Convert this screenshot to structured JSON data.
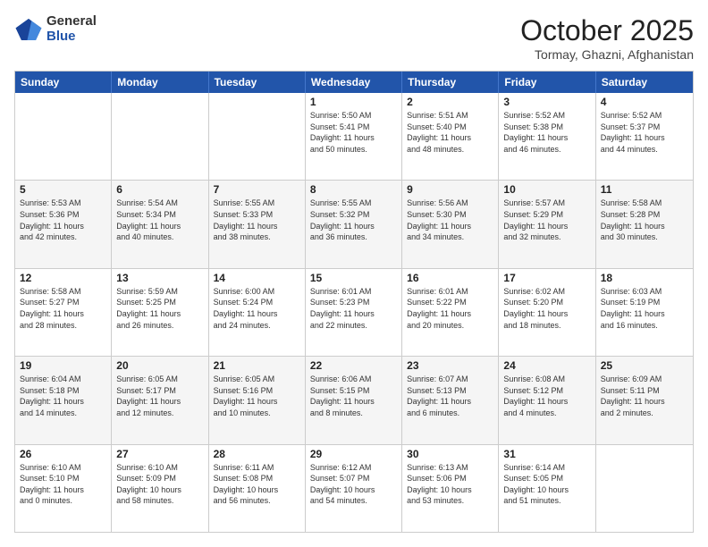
{
  "logo": {
    "general": "General",
    "blue": "Blue"
  },
  "header": {
    "month": "October 2025",
    "location": "Tormay, Ghazni, Afghanistan"
  },
  "weekdays": [
    "Sunday",
    "Monday",
    "Tuesday",
    "Wednesday",
    "Thursday",
    "Friday",
    "Saturday"
  ],
  "weeks": [
    [
      {
        "day": "",
        "text": ""
      },
      {
        "day": "",
        "text": ""
      },
      {
        "day": "",
        "text": ""
      },
      {
        "day": "1",
        "text": "Sunrise: 5:50 AM\nSunset: 5:41 PM\nDaylight: 11 hours\nand 50 minutes."
      },
      {
        "day": "2",
        "text": "Sunrise: 5:51 AM\nSunset: 5:40 PM\nDaylight: 11 hours\nand 48 minutes."
      },
      {
        "day": "3",
        "text": "Sunrise: 5:52 AM\nSunset: 5:38 PM\nDaylight: 11 hours\nand 46 minutes."
      },
      {
        "day": "4",
        "text": "Sunrise: 5:52 AM\nSunset: 5:37 PM\nDaylight: 11 hours\nand 44 minutes."
      }
    ],
    [
      {
        "day": "5",
        "text": "Sunrise: 5:53 AM\nSunset: 5:36 PM\nDaylight: 11 hours\nand 42 minutes."
      },
      {
        "day": "6",
        "text": "Sunrise: 5:54 AM\nSunset: 5:34 PM\nDaylight: 11 hours\nand 40 minutes."
      },
      {
        "day": "7",
        "text": "Sunrise: 5:55 AM\nSunset: 5:33 PM\nDaylight: 11 hours\nand 38 minutes."
      },
      {
        "day": "8",
        "text": "Sunrise: 5:55 AM\nSunset: 5:32 PM\nDaylight: 11 hours\nand 36 minutes."
      },
      {
        "day": "9",
        "text": "Sunrise: 5:56 AM\nSunset: 5:30 PM\nDaylight: 11 hours\nand 34 minutes."
      },
      {
        "day": "10",
        "text": "Sunrise: 5:57 AM\nSunset: 5:29 PM\nDaylight: 11 hours\nand 32 minutes."
      },
      {
        "day": "11",
        "text": "Sunrise: 5:58 AM\nSunset: 5:28 PM\nDaylight: 11 hours\nand 30 minutes."
      }
    ],
    [
      {
        "day": "12",
        "text": "Sunrise: 5:58 AM\nSunset: 5:27 PM\nDaylight: 11 hours\nand 28 minutes."
      },
      {
        "day": "13",
        "text": "Sunrise: 5:59 AM\nSunset: 5:25 PM\nDaylight: 11 hours\nand 26 minutes."
      },
      {
        "day": "14",
        "text": "Sunrise: 6:00 AM\nSunset: 5:24 PM\nDaylight: 11 hours\nand 24 minutes."
      },
      {
        "day": "15",
        "text": "Sunrise: 6:01 AM\nSunset: 5:23 PM\nDaylight: 11 hours\nand 22 minutes."
      },
      {
        "day": "16",
        "text": "Sunrise: 6:01 AM\nSunset: 5:22 PM\nDaylight: 11 hours\nand 20 minutes."
      },
      {
        "day": "17",
        "text": "Sunrise: 6:02 AM\nSunset: 5:20 PM\nDaylight: 11 hours\nand 18 minutes."
      },
      {
        "day": "18",
        "text": "Sunrise: 6:03 AM\nSunset: 5:19 PM\nDaylight: 11 hours\nand 16 minutes."
      }
    ],
    [
      {
        "day": "19",
        "text": "Sunrise: 6:04 AM\nSunset: 5:18 PM\nDaylight: 11 hours\nand 14 minutes."
      },
      {
        "day": "20",
        "text": "Sunrise: 6:05 AM\nSunset: 5:17 PM\nDaylight: 11 hours\nand 12 minutes."
      },
      {
        "day": "21",
        "text": "Sunrise: 6:05 AM\nSunset: 5:16 PM\nDaylight: 11 hours\nand 10 minutes."
      },
      {
        "day": "22",
        "text": "Sunrise: 6:06 AM\nSunset: 5:15 PM\nDaylight: 11 hours\nand 8 minutes."
      },
      {
        "day": "23",
        "text": "Sunrise: 6:07 AM\nSunset: 5:13 PM\nDaylight: 11 hours\nand 6 minutes."
      },
      {
        "day": "24",
        "text": "Sunrise: 6:08 AM\nSunset: 5:12 PM\nDaylight: 11 hours\nand 4 minutes."
      },
      {
        "day": "25",
        "text": "Sunrise: 6:09 AM\nSunset: 5:11 PM\nDaylight: 11 hours\nand 2 minutes."
      }
    ],
    [
      {
        "day": "26",
        "text": "Sunrise: 6:10 AM\nSunset: 5:10 PM\nDaylight: 11 hours\nand 0 minutes."
      },
      {
        "day": "27",
        "text": "Sunrise: 6:10 AM\nSunset: 5:09 PM\nDaylight: 10 hours\nand 58 minutes."
      },
      {
        "day": "28",
        "text": "Sunrise: 6:11 AM\nSunset: 5:08 PM\nDaylight: 10 hours\nand 56 minutes."
      },
      {
        "day": "29",
        "text": "Sunrise: 6:12 AM\nSunset: 5:07 PM\nDaylight: 10 hours\nand 54 minutes."
      },
      {
        "day": "30",
        "text": "Sunrise: 6:13 AM\nSunset: 5:06 PM\nDaylight: 10 hours\nand 53 minutes."
      },
      {
        "day": "31",
        "text": "Sunrise: 6:14 AM\nSunset: 5:05 PM\nDaylight: 10 hours\nand 51 minutes."
      },
      {
        "day": "",
        "text": ""
      }
    ]
  ]
}
